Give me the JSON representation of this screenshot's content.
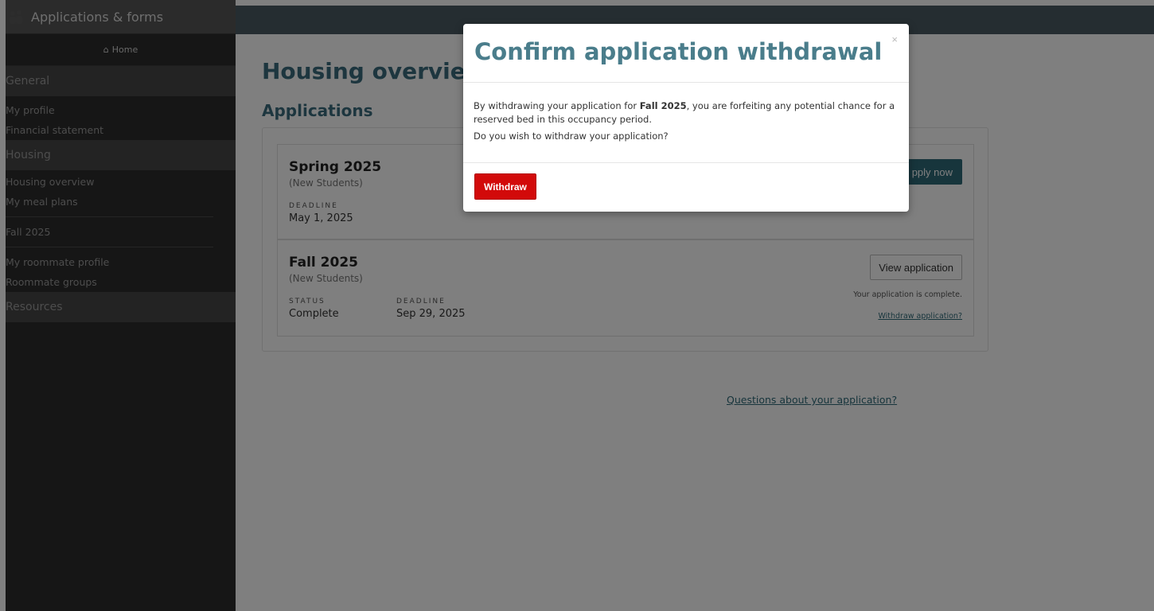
{
  "sidebar": {
    "app_title": "Applications & forms",
    "home_label": "Home",
    "sections": [
      {
        "title": "General",
        "items": [
          "My profile",
          "Financial statement"
        ]
      },
      {
        "title": "Housing",
        "items": [
          "Housing overview",
          "My meal plans",
          "Fall 2025",
          "My roommate profile",
          "Roommate groups"
        ]
      },
      {
        "title": "Resources",
        "items": []
      }
    ]
  },
  "main": {
    "page_title": "Housing overvie",
    "section_title": "Applications",
    "cards": [
      {
        "term": "Spring 2025",
        "audience": "(New Students)",
        "deadline_label": "DEADLINE",
        "deadline": "May 1, 2025",
        "action_label": "pply now"
      },
      {
        "term": "Fall 2025",
        "audience": "(New Students)",
        "status_label": "STATUS",
        "status": "Complete",
        "deadline_label": "DEADLINE",
        "deadline": "Sep 29, 2025",
        "action_label": "View application",
        "note": "Your application is complete.",
        "withdraw_link": "Withdraw application?"
      }
    ],
    "questions_link": "Questions about your application?"
  },
  "modal": {
    "title": "Confirm application withdrawal",
    "close_label": "×",
    "body_pre": "By withdrawing your application for ",
    "body_term": "Fall 2025",
    "body_post": ", you are forfeiting any potential chance for a reserved bed in this occupancy period.",
    "question": "Do you wish to withdraw your application?",
    "withdraw_label": "Withdraw"
  },
  "colors": {
    "accent": "#2f6a79",
    "danger": "#d20a0a",
    "sidebar_bg": "#2d2d2d",
    "topbar_bg": "#4b5a63"
  }
}
